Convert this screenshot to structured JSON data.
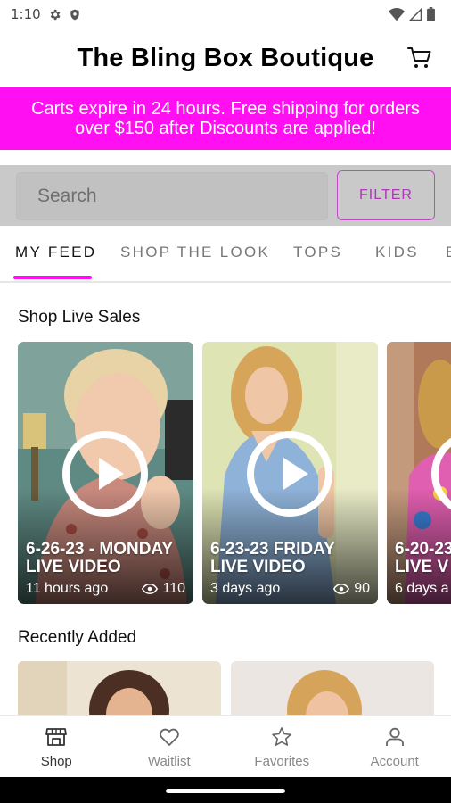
{
  "status_bar": {
    "time": "1:10"
  },
  "header": {
    "title": "The Bling Box Boutique"
  },
  "promo": {
    "line1": "Carts expire in 24 hours. Free shipping for orders",
    "line2": "over $150 after Discounts are applied!"
  },
  "search": {
    "placeholder": "Search",
    "filter_label": "FILTER"
  },
  "tabs": [
    {
      "label": "MY FEED",
      "active": true
    },
    {
      "label": "SHOP THE LOOK",
      "active": false
    },
    {
      "label": "TOPS",
      "active": false
    },
    {
      "label": "KIDS",
      "active": false
    },
    {
      "label": "B",
      "active": false
    }
  ],
  "live_sales": {
    "title": "Shop Live Sales",
    "videos": [
      {
        "title": "6-26-23 - MONDAY\nLIVE VIDEO",
        "time": "11 hours ago",
        "views": "110"
      },
      {
        "title": "6-23-23 FRIDAY\nLIVE VIDEO",
        "time": "3 days ago",
        "views": "90"
      },
      {
        "title": "6-20-23\nLIVE V",
        "time": "6 days a",
        "views": ""
      }
    ]
  },
  "recently_added": {
    "title": "Recently Added"
  },
  "bottom_nav": [
    {
      "label": "Shop",
      "icon": "store-icon",
      "active": true
    },
    {
      "label": "Waitlist",
      "icon": "heart-icon",
      "active": false
    },
    {
      "label": "Favorites",
      "icon": "star-icon",
      "active": false
    },
    {
      "label": "Account",
      "icon": "person-icon",
      "active": false
    }
  ],
  "colors": {
    "brand_magenta": "#ff0ff2",
    "filter_purple": "#b036b8"
  }
}
